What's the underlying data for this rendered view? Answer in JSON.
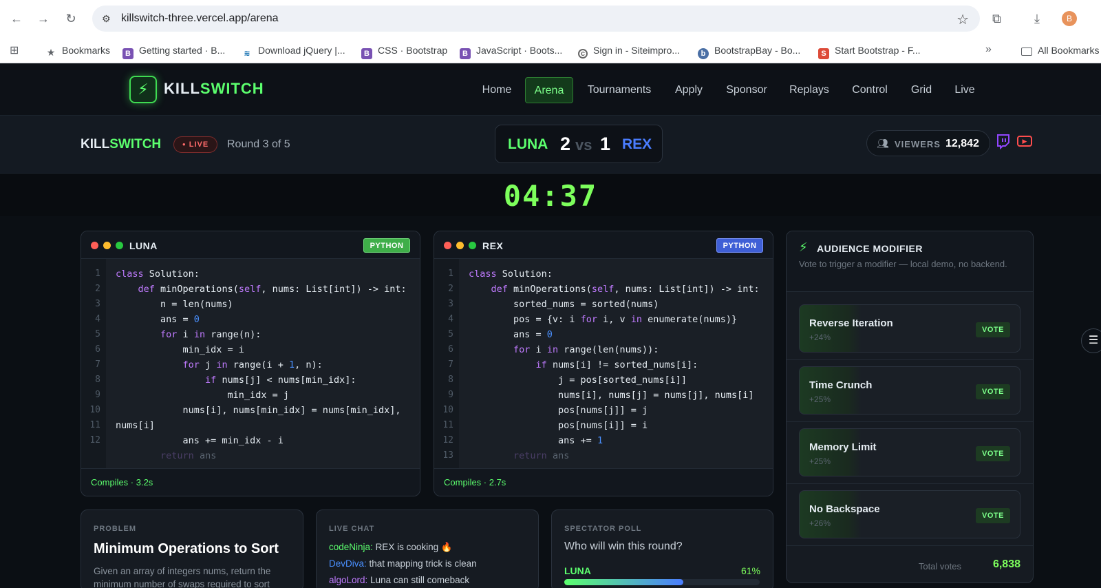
{
  "browser": {
    "url": "killswitch-three.vercel.app/arena",
    "bookmarks": [
      {
        "label": "Bookmarks",
        "color": "#5f6368"
      },
      {
        "label": "Getting started · B...",
        "color": "#7952b3"
      },
      {
        "label": "Download jQuery |...",
        "color": "#0769ad"
      },
      {
        "label": "CSS · Bootstrap",
        "color": "#7952b3"
      },
      {
        "label": "JavaScript · Boots...",
        "color": "#7952b3"
      },
      {
        "label": "Sign in - Siteimpro...",
        "color": "#666666"
      },
      {
        "label": "BootstrapBay - Bo...",
        "color": "#4a6fa5"
      },
      {
        "label": "Start Bootstrap - F...",
        "color": "#dd4b39"
      }
    ],
    "all_bookmarks": "All Bookmarks",
    "avatar_letter": "B"
  },
  "site": {
    "logo_a": "KILL",
    "logo_b": "SWITCH",
    "nav": [
      "Home",
      "Arena",
      "Tournaments",
      "Apply",
      "Sponsor",
      "Replays",
      "Control",
      "Grid",
      "Live"
    ],
    "active_nav": "Arena",
    "accent": "#5cff6e"
  },
  "match": {
    "brand_a": "KILL",
    "brand_b": "SWITCH",
    "live": "LIVE",
    "round": "Round 3 of 5",
    "player1": "LUNA",
    "score1": "2",
    "vs": "vs",
    "score2": "1",
    "player2": "REX",
    "viewers_label": "VIEWERS",
    "viewers": "12,842",
    "timer": "04:37"
  },
  "editors": {
    "luna": {
      "name": "LUNA",
      "lang": "PYTHON",
      "lang_color": "#3fae49",
      "status": "Compiles · 3.2s",
      "line_numbers": [
        "1",
        "2",
        "3",
        "4",
        "5",
        "6",
        "7",
        "8",
        "9",
        "10",
        "11",
        "12"
      ]
    },
    "rex": {
      "name": "REX",
      "lang": "PYTHON",
      "lang_color": "#3f5fd6",
      "status": "Compiles · 2.7s",
      "line_numbers": [
        "1",
        "2",
        "3",
        "4",
        "5",
        "6",
        "7",
        "8",
        "9",
        "10",
        "11",
        "12",
        "13"
      ]
    }
  },
  "audience": {
    "title": "AUDIENCE MODIFIER",
    "subtitle": "Vote to trigger a modifier — local demo, no backend.",
    "modifiers": [
      {
        "name": "Reverse Iteration",
        "pct": "+24%"
      },
      {
        "name": "Time Crunch",
        "pct": "+25%"
      },
      {
        "name": "Memory Limit",
        "pct": "+25%"
      },
      {
        "name": "No Backspace",
        "pct": "+26%"
      }
    ],
    "vote_label": "VOTE",
    "total_label": "Total votes",
    "total": "6,838"
  },
  "problem": {
    "label": "PROBLEM",
    "title": "Minimum Operations to Sort",
    "desc": "Given an array of integers nums, return the minimum number of swaps required to sort"
  },
  "chat": {
    "label": "LIVE CHAT",
    "messages": [
      {
        "user": "codeNinja:",
        "text": "REX is cooking 🔥",
        "color": "#5cff6e"
      },
      {
        "user": "DevDiva:",
        "text": "that mapping trick is clean",
        "color": "#4a90ff"
      },
      {
        "user": "algoLord:",
        "text": "Luna can still comeback",
        "color": "#c07bff"
      }
    ]
  },
  "poll": {
    "label": "SPECTATOR POLL",
    "question": "Who will win this round?",
    "option": "LUNA",
    "pct": "61%",
    "value": 61
  }
}
